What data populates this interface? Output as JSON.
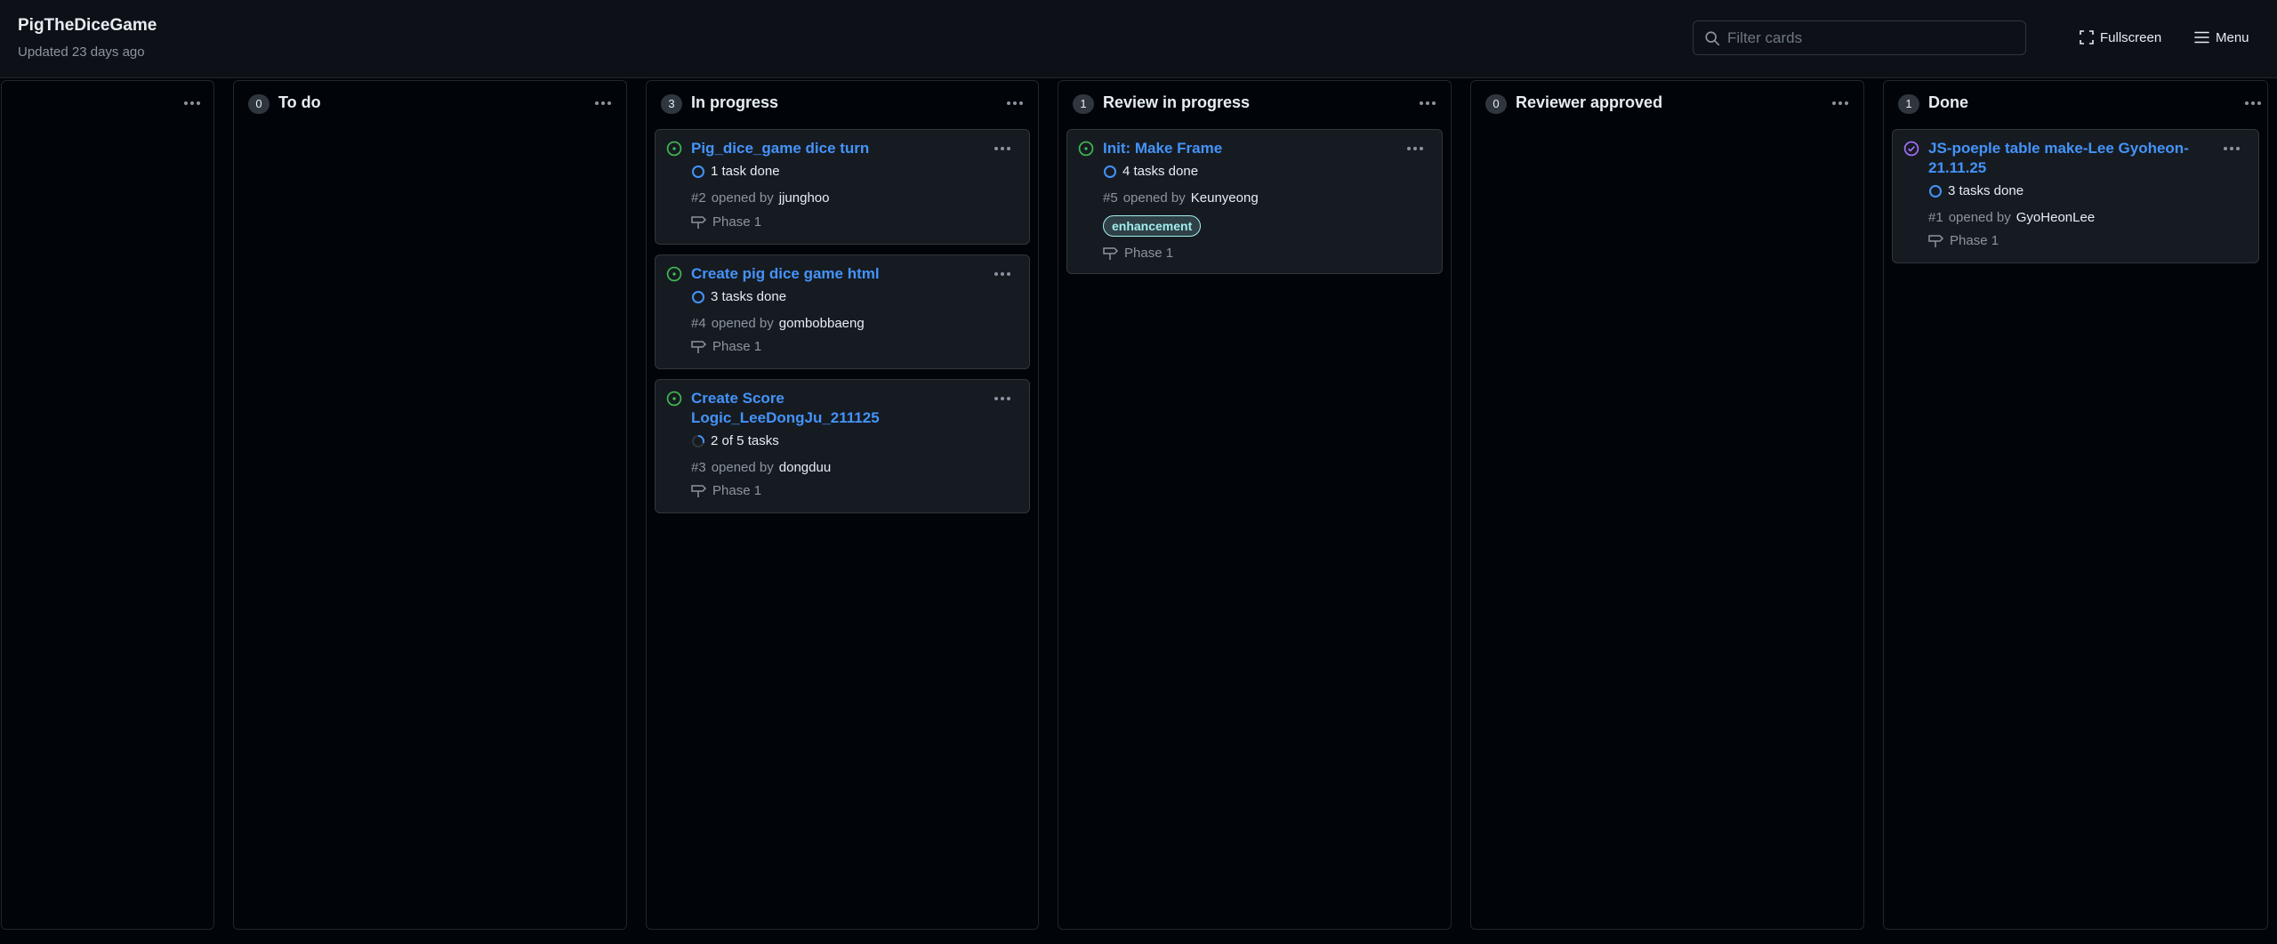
{
  "header": {
    "title": "PigTheDiceGame",
    "updated": "Updated 23 days ago",
    "filter_placeholder": "Filter cards",
    "fullscreen_label": "Fullscreen",
    "menu_label": "Menu"
  },
  "columns": [
    {
      "title": "",
      "count": "",
      "cards": []
    },
    {
      "title": "To do",
      "count": "0",
      "cards": []
    },
    {
      "title": "In progress",
      "count": "3",
      "cards": [
        {
          "title": "Pig_dice_game dice turn",
          "tasks": "1 task done",
          "number": "#2",
          "opened_by": "opened by",
          "author": "jjunghoo",
          "milestone": "Phase 1",
          "status_color": "#3fb950"
        },
        {
          "title": "Create pig dice game html",
          "tasks": "3 tasks done",
          "number": "#4",
          "opened_by": "opened by",
          "author": "gombobbaeng",
          "milestone": "Phase 1",
          "status_color": "#3fb950"
        },
        {
          "title": "Create Score Logic_LeeDongJu_211125",
          "tasks": "2 of 5 tasks",
          "number": "#3",
          "opened_by": "opened by",
          "author": "dongduu",
          "milestone": "Phase 1",
          "status_color": "#3fb950"
        }
      ]
    },
    {
      "title": "Review in progress",
      "count": "1",
      "cards": [
        {
          "title": "Init: Make Frame",
          "tasks": "4 tasks done",
          "number": "#5",
          "opened_by": "opened by",
          "author": "Keunyeong",
          "label": "enhancement",
          "milestone": "Phase 1",
          "status_color": "#3fb950"
        }
      ]
    },
    {
      "title": "Reviewer approved",
      "count": "0",
      "cards": []
    },
    {
      "title": "Done",
      "count": "1",
      "cards": [
        {
          "title": "JS-poeple table make-Lee Gyoheon-21.11.25",
          "tasks": "3 tasks done",
          "number": "#1",
          "opened_by": "opened by",
          "author": "GyoHeonLee",
          "milestone": "Phase 1",
          "status_color": "#a371f7"
        }
      ]
    }
  ],
  "colors": {
    "link": "#4493f8",
    "open_issue": "#3fb950",
    "closed_issue": "#a371f7",
    "label_enhancement": "#a2eeef",
    "background": "#010409"
  },
  "icons": {
    "open": "issue-opened-icon",
    "closed": "issue-closed-icon",
    "tasks": "task-progress-icon",
    "milestone": "milestone-icon",
    "kebab": "kebab-horizontal-icon"
  }
}
